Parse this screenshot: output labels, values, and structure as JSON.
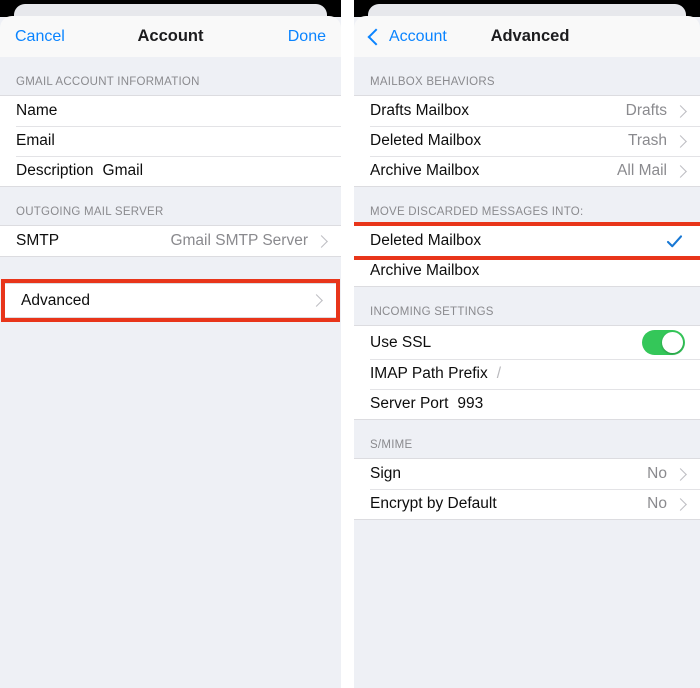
{
  "left_screen": {
    "nav": {
      "cancel_label": "Cancel",
      "title": "Account",
      "done_label": "Done"
    },
    "sections": [
      {
        "header": "GMAIL ACCOUNT INFORMATION",
        "rows": [
          {
            "label": "Name",
            "inline_value": "",
            "value": "",
            "chevron": false
          },
          {
            "label": "Email",
            "inline_value": "",
            "value": "",
            "chevron": false
          },
          {
            "label": "Description",
            "inline_value": "Gmail",
            "value": "",
            "chevron": false
          }
        ]
      },
      {
        "header": "OUTGOING MAIL SERVER",
        "rows": [
          {
            "label": "SMTP",
            "inline_value": "",
            "value": "Gmail SMTP Server",
            "chevron": true
          }
        ]
      },
      {
        "header": "",
        "rows": [
          {
            "label": "Advanced",
            "inline_value": "",
            "value": "",
            "chevron": true,
            "highlighted": true
          }
        ]
      }
    ]
  },
  "right_screen": {
    "nav": {
      "back_label": "Account",
      "title": "Advanced"
    },
    "sections": [
      {
        "header": "MAILBOX BEHAVIORS",
        "rows": [
          {
            "label": "Drafts Mailbox",
            "value": "Drafts",
            "chevron": true
          },
          {
            "label": "Deleted Mailbox",
            "value": "Trash",
            "chevron": true
          },
          {
            "label": "Archive Mailbox",
            "value": "All Mail",
            "chevron": true
          }
        ]
      },
      {
        "header": "MOVE DISCARDED MESSAGES INTO:",
        "rows": [
          {
            "label": "Deleted Mailbox",
            "value": "",
            "checked": true,
            "highlighted": true
          },
          {
            "label": "Archive Mailbox",
            "value": "",
            "checked": false
          }
        ]
      },
      {
        "header": "INCOMING SETTINGS",
        "rows": [
          {
            "label": "Use SSL",
            "toggle_on": true
          },
          {
            "label": "IMAP Path Prefix",
            "inline_value": "/"
          },
          {
            "label": "Server Port",
            "inline_value": "993"
          }
        ]
      },
      {
        "header": "S/MIME",
        "rows": [
          {
            "label": "Sign",
            "value": "No",
            "chevron": true
          },
          {
            "label": "Encrypt by Default",
            "value": "No",
            "chevron": true
          }
        ]
      }
    ]
  },
  "colors": {
    "accent_blue": "#0a84ff",
    "toggle_green": "#34c759",
    "highlight_red": "#e8351a",
    "background_gray": "#eef0f5"
  }
}
